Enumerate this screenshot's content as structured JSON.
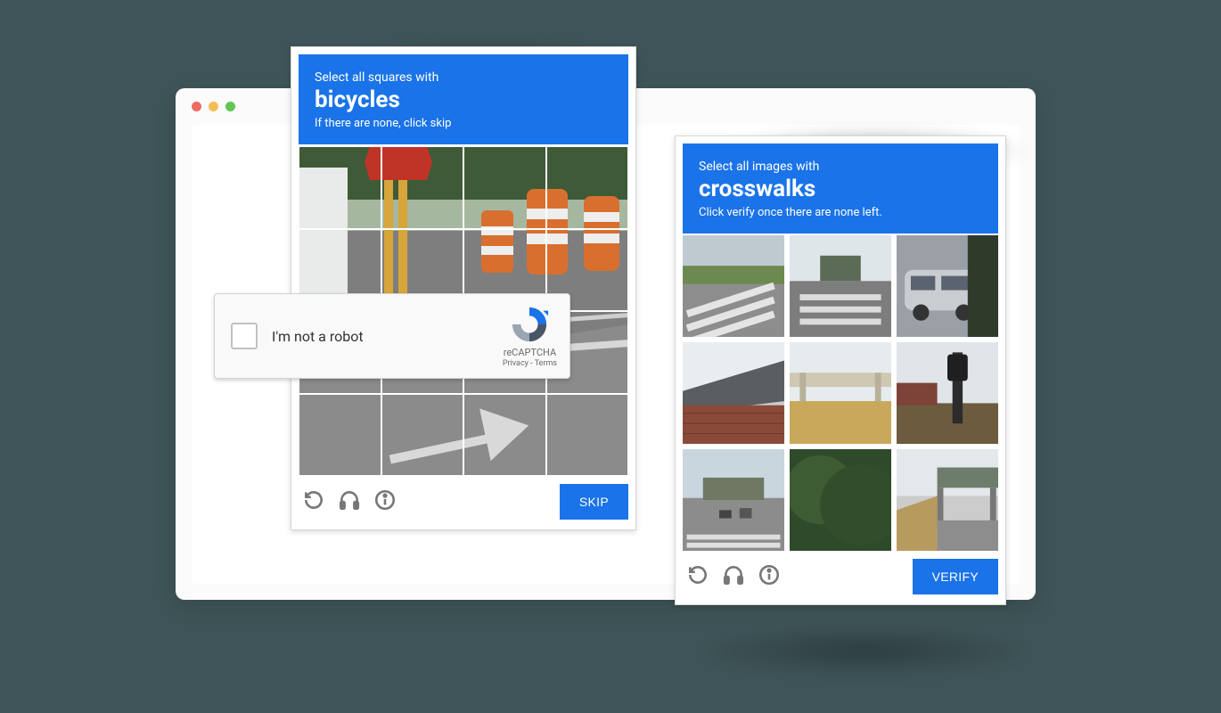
{
  "browser": {
    "traffic_lights": [
      "red",
      "yellow",
      "green"
    ]
  },
  "recaptcha_widget": {
    "label": "I'm not a robot",
    "brand": "reCAPTCHA",
    "privacy": "Privacy",
    "terms": "Terms",
    "separator": " - "
  },
  "left_panel": {
    "line1": "Select all squares with",
    "target": "bicycles",
    "line3": "If there are none, click skip",
    "action_label": "SKIP",
    "grid": {
      "rows": 4,
      "cols": 4
    },
    "footer_icons": [
      "refresh-icon",
      "headphones-icon",
      "info-icon"
    ]
  },
  "right_panel": {
    "line1": "Select all images with",
    "target": "crosswalks",
    "line3": "Click verify once there are none left.",
    "action_label": "VERIFY",
    "grid": {
      "rows": 3,
      "cols": 3
    },
    "footer_icons": [
      "refresh-icon",
      "headphones-icon",
      "info-icon"
    ],
    "tiles": [
      "crosswalk-stripes",
      "intersection-crosswalk",
      "parked-van",
      "house-roof",
      "highway-overpass",
      "traffic-light-pole",
      "town-street",
      "trees",
      "underpass"
    ]
  }
}
